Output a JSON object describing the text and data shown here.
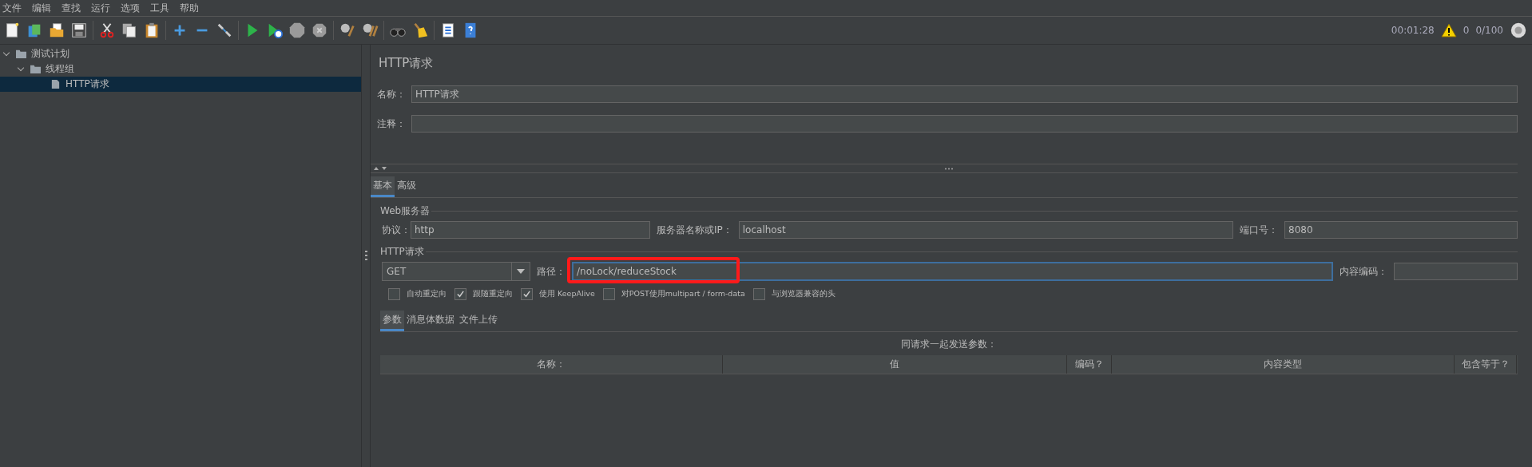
{
  "menu": [
    "文件",
    "编辑",
    "查找",
    "运行",
    "选项",
    "工具",
    "帮助"
  ],
  "status": {
    "timer": "00:01:28",
    "warnings": "0",
    "threads": "0/100"
  },
  "tree": [
    {
      "label": "测试计划",
      "kind": "folder",
      "expanded": true,
      "selected": false,
      "children": [
        {
          "label": "线程组",
          "kind": "folder",
          "expanded": true,
          "selected": false,
          "children": [
            {
              "label": "HTTP请求",
              "kind": "file",
              "selected": true
            }
          ]
        }
      ]
    }
  ],
  "panel": {
    "title": "HTTP请求",
    "name_label": "名称：",
    "name_value": "HTTP请求",
    "comment_label": "注释："
  },
  "tabs": [
    {
      "label": "基本",
      "selected": true
    },
    {
      "label": "高级",
      "selected": false
    }
  ],
  "web_server": {
    "legend": "Web服务器",
    "protocol_label": "协议：",
    "protocol": "http",
    "host_label": "服务器名称或IP：",
    "host": "localhost",
    "port_label": "端口号：",
    "port": "8080"
  },
  "http_request": {
    "legend": "HTTP请求",
    "method": "GET",
    "path_label": "路径：",
    "path": "/noLock/reduceStock",
    "encoding_label": "内容编码："
  },
  "options": [
    {
      "label": "自动重定向",
      "checked": false
    },
    {
      "label": "跟随重定向",
      "checked": true
    },
    {
      "label": "使用 KeepAlive",
      "checked": true
    },
    {
      "label": "对POST使用multipart / form-data",
      "checked": false
    },
    {
      "label": "与浏览器兼容的头",
      "checked": false
    }
  ],
  "sub_tabs": [
    {
      "label": "参数",
      "selected": true
    },
    {
      "label": "消息体数据",
      "selected": false
    },
    {
      "label": "文件上传",
      "selected": false
    }
  ],
  "params": {
    "caption": "同请求一起发送参数：",
    "columns": [
      "名称：",
      "值",
      "编码？",
      "内容类型",
      "包含等于？"
    ]
  }
}
